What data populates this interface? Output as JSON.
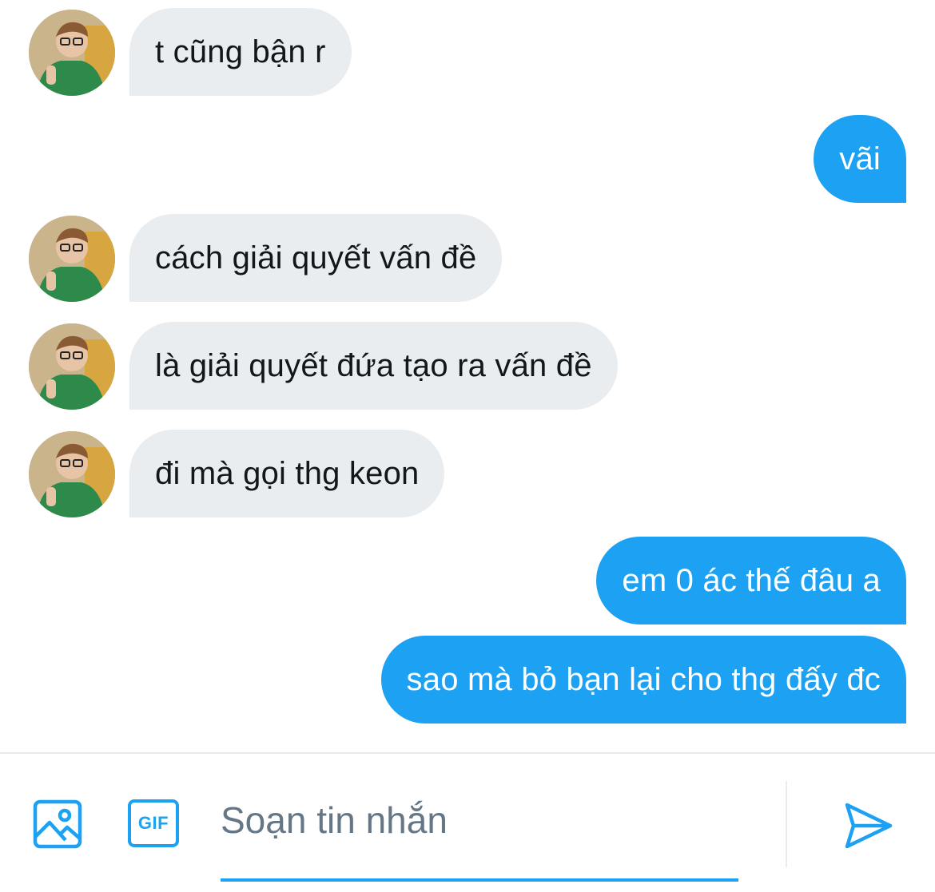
{
  "conversation": {
    "messages": [
      {
        "direction": "in",
        "text": "t cũng bận r"
      },
      {
        "direction": "out",
        "text": "vãi"
      },
      {
        "direction": "in",
        "text": "cách giải quyết vấn đề"
      },
      {
        "direction": "in",
        "text": "là giải quyết đứa tạo ra vấn đề"
      },
      {
        "direction": "in",
        "text": "đi mà gọi thg keon"
      },
      {
        "direction": "out",
        "text": "em 0 ác thế đâu a"
      },
      {
        "direction": "out",
        "text": "sao mà bỏ bạn lại cho thg đấy đc"
      }
    ]
  },
  "composer": {
    "image_icon": "image-icon",
    "gif_label": "GIF",
    "placeholder": "Soạn tin nhắn",
    "value": "",
    "send_icon": "send-icon"
  },
  "colors": {
    "accent": "#1da1f2",
    "incoming_bubble": "#e9edf0",
    "incoming_text": "#14171a",
    "outgoing_text": "#ffffff",
    "placeholder": "#657786"
  }
}
